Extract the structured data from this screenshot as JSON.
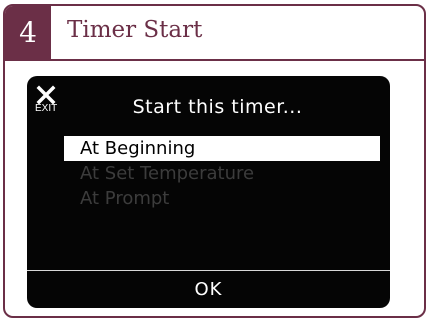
{
  "header": {
    "step_number": "4",
    "title": "Timer Start"
  },
  "screen": {
    "exit_icon": "close-icon",
    "exit_label": "EXIT",
    "title": "Start this timer...",
    "options": [
      {
        "label": "At Beginning",
        "selected": true
      },
      {
        "label": "At Set Temperature",
        "selected": false
      },
      {
        "label": "At Prompt",
        "selected": false
      }
    ],
    "ok_label": "OK"
  },
  "colors": {
    "brand": "#6b2f47",
    "screen_background": "#050505",
    "inactive_option_text": "#3c3c3c"
  }
}
